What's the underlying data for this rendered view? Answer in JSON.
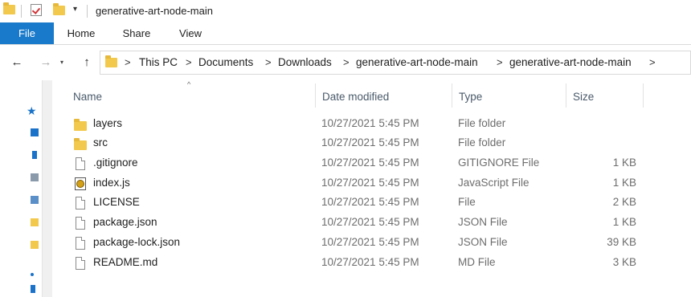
{
  "window": {
    "title": "generative-art-node-main"
  },
  "quick_access": {
    "icons": [
      "folder-icon",
      "properties-icon",
      "new-folder-icon",
      "customize-dropdown-icon"
    ],
    "dropdown_glyph": "▾"
  },
  "ribbon": {
    "tabs": [
      {
        "label": "File",
        "active": true
      },
      {
        "label": "Home"
      },
      {
        "label": "Share"
      },
      {
        "label": "View"
      }
    ],
    "accent": "#1979ca"
  },
  "nav": {
    "back_glyph": "←",
    "forward_glyph": "→",
    "recent_glyph": "▾",
    "up_glyph": "↑",
    "breadcrumb_sep": ">",
    "breadcrumb": [
      "This PC",
      "Documents",
      "Downloads",
      "generative-art-node-main",
      "generative-art-node-main"
    ]
  },
  "columns": {
    "name": "Name",
    "date": "Date modified",
    "type": "Type",
    "size": "Size",
    "sort_glyph": "^"
  },
  "files": [
    {
      "icon": "folder-icon",
      "name": "layers",
      "date": "10/27/2021 5:45 PM",
      "type": "File folder",
      "size": ""
    },
    {
      "icon": "folder-icon",
      "name": "src",
      "date": "10/27/2021 5:45 PM",
      "type": "File folder",
      "size": ""
    },
    {
      "icon": "file-icon",
      "name": ".gitignore",
      "date": "10/27/2021 5:45 PM",
      "type": "GITIGNORE File",
      "size": "1 KB"
    },
    {
      "icon": "javascript-file-icon",
      "name": "index.js",
      "date": "10/27/2021 5:45 PM",
      "type": "JavaScript File",
      "size": "1 KB"
    },
    {
      "icon": "file-icon",
      "name": "LICENSE",
      "date": "10/27/2021 5:45 PM",
      "type": "File",
      "size": "2 KB"
    },
    {
      "icon": "file-icon",
      "name": "package.json",
      "date": "10/27/2021 5:45 PM",
      "type": "JSON File",
      "size": "1 KB"
    },
    {
      "icon": "file-icon",
      "name": "package-lock.json",
      "date": "10/27/2021 5:45 PM",
      "type": "JSON File",
      "size": "39 KB"
    },
    {
      "icon": "file-icon",
      "name": "README.md",
      "date": "10/27/2021 5:45 PM",
      "type": "MD File",
      "size": "3 KB"
    }
  ],
  "nav_pane": {
    "pin_glyph": "★"
  }
}
